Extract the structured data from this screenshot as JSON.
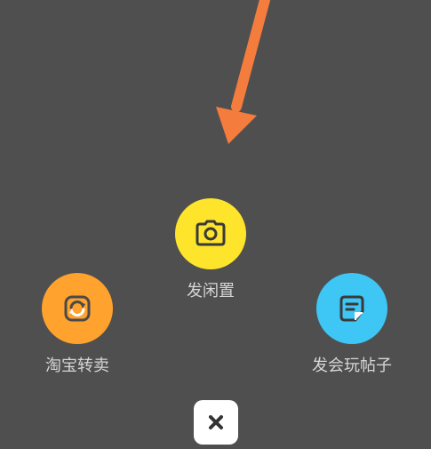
{
  "actions": [
    {
      "id": "camera",
      "label": "发闲置",
      "icon": "camera-icon",
      "color": "#ffe42c"
    },
    {
      "id": "taobao",
      "label": "淘宝转卖",
      "icon": "resell-icon",
      "color": "#ffa22e"
    },
    {
      "id": "post",
      "label": "发会玩帖子",
      "icon": "post-note-icon",
      "color": "#3ec6f5"
    }
  ],
  "close": {
    "icon": "close-icon"
  },
  "annotation": {
    "icon": "pointer-arrow-icon",
    "color": "#f47c3c"
  },
  "colors": {
    "background": "#4f4f4f",
    "label_text": "#d6d6d6"
  }
}
